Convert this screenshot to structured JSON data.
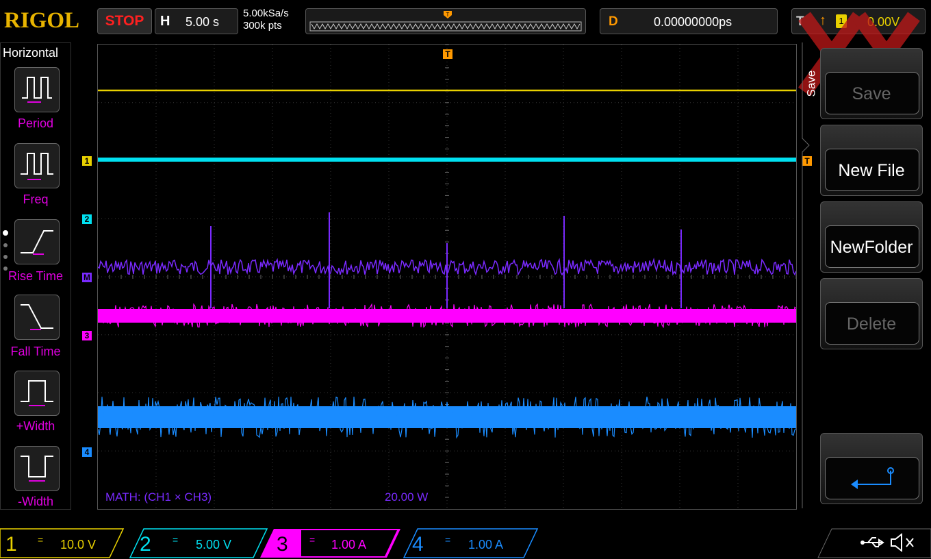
{
  "brand": "RIGOL",
  "run_state": "STOP",
  "horizontal": {
    "label": "H",
    "timebase": "5.00 s",
    "sample_rate": "5.00kSa/s",
    "memory_depth": "300k pts"
  },
  "delay": {
    "label": "D",
    "value": "0.00000000ps"
  },
  "trigger": {
    "label": "T",
    "level": "0.00V",
    "source": "1"
  },
  "left_menu": {
    "title": "Horizontal",
    "items": [
      {
        "label": "Period",
        "icon": "period-icon"
      },
      {
        "label": "Freq",
        "icon": "frequency-icon"
      },
      {
        "label": "Rise Time",
        "icon": "rise-time-icon"
      },
      {
        "label": "Fall Time",
        "icon": "fall-time-icon"
      },
      {
        "label": "+Width",
        "icon": "positive-width-icon"
      },
      {
        "label": "-Width",
        "icon": "negative-width-icon"
      }
    ]
  },
  "right_menu": {
    "tab_label": "Save",
    "items": [
      {
        "label": "Save",
        "enabled": false
      },
      {
        "label": "New File",
        "enabled": true
      },
      {
        "label": "NewFolder",
        "enabled": true
      },
      {
        "label": "Delete",
        "enabled": false
      }
    ],
    "back_icon": "return-arrow-icon"
  },
  "screen": {
    "markers": {
      "ch1": "1",
      "ch2": "2",
      "math": "M",
      "ch3": "3",
      "ch4": "4",
      "trigger": "T"
    },
    "math_label": "MATH: (CH1 × CH3)",
    "math_scale": "20.00 W"
  },
  "channels": [
    {
      "num": "1",
      "coupling": "=",
      "scale": "10.0 V",
      "color": "#e8d000"
    },
    {
      "num": "2",
      "coupling": "=",
      "scale": "5.00 V",
      "color": "#00e0f0"
    },
    {
      "num": "3",
      "coupling": "=",
      "scale": "1.00 A",
      "color": "#ff00ff"
    },
    {
      "num": "4",
      "coupling": "=",
      "scale": "1.00 A",
      "color": "#1a8cff"
    }
  ],
  "status_icons": [
    "usb-icon",
    "speaker-muted-icon"
  ],
  "colors": {
    "ch1": "#e8d000",
    "ch2": "#00e0f0",
    "ch3": "#ff00ff",
    "ch4": "#1a8cff",
    "math": "#7a2aff",
    "trigger": "#ff9900",
    "brand": "#e8b400"
  }
}
